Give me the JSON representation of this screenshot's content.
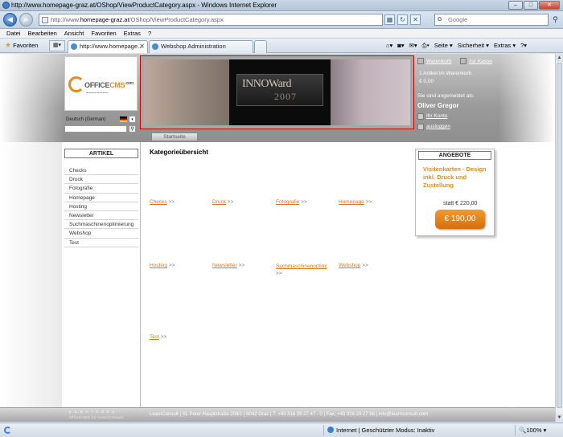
{
  "browser": {
    "title": "http://www.homepage-graz.at/OShop/ViewProductCategory.aspx - Windows Internet Explorer",
    "url_prefix": "http://www.",
    "url_domain": "homepage-graz.at",
    "url_path": "/OShop/ViewProductCategory.aspx",
    "search_placeholder": "Google",
    "menu": [
      "Datei",
      "Bearbeiten",
      "Ansicht",
      "Favoriten",
      "Extras",
      "?"
    ],
    "favorites_label": "Favoriten",
    "tabs": [
      {
        "label": "http://www.homepage..."
      },
      {
        "label": "Webshop Administration"
      }
    ],
    "commands": {
      "page": "Seite",
      "security": "Sicherheit",
      "tools": "Extras"
    },
    "status": {
      "zone": "Internet | Geschützter Modus: Inaktiv",
      "zoom": "100%"
    }
  },
  "site": {
    "logo": {
      "brand_a": "OFFICE",
      "brand_b": "CMS",
      "suffix": ".com"
    },
    "language": "Deutsch (German)",
    "banner_text_a": "INNOWard",
    "banner_text_b": "2007",
    "cart": {
      "cart_link": "Warenkorb",
      "checkout_link": "zur Kasse",
      "count_text": "1 Artikel im Warenkorb",
      "total": "€ 0,00",
      "logged_in_text": "Sie sind angemeldet als:",
      "username": "Oliver Gregor",
      "account_link": "Ihr Konto",
      "logout_link": "ausloggen"
    },
    "nav": {
      "start": "Startseite"
    },
    "sidebar": {
      "title": "ARTIKEL",
      "items": [
        "Checks",
        "Druck",
        "Fotografie",
        "Homepage",
        "Hosting",
        "Newsletter",
        "Suchmaschinenoptimierung",
        "Webshop",
        "Test"
      ]
    },
    "main": {
      "title": "Kategorieübersicht",
      "arrow": ">>",
      "categories": [
        "Checks",
        "Druck",
        "Fotografie",
        "Homepage",
        "Hosting",
        "Newsletter",
        "Suchmaschinenoptimi",
        "Webshop",
        "Test"
      ]
    },
    "offer": {
      "title": "ANGEBOTE",
      "text": "Visitenkarten - Design inkl. Druck und Zustellung",
      "old_price": "statt € 220,00",
      "price": "€ 190,00"
    },
    "footer": {
      "powered_a": "p o w e r e d   b y",
      "powered_b": "OfficeCMS by LearnConsult",
      "address": "LearnConsult | St. Peter Hauptstraße 208/1 | 8042 Graz | T: +43 316 29 27 47 - 0 | Fax: +43 316 29 27 98 | info@learnconsult.com"
    }
  }
}
